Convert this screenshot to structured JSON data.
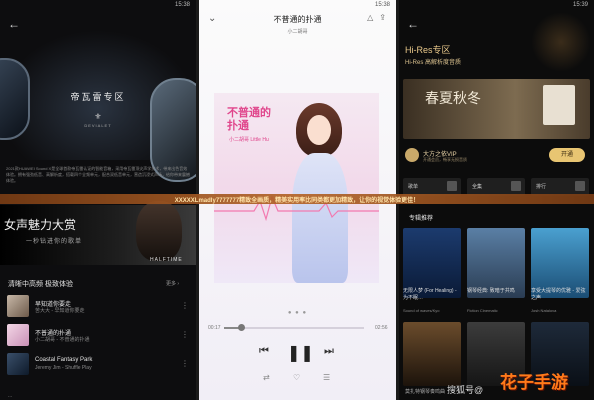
{
  "panel1": {
    "status": {
      "left": "",
      "time": "15:38"
    },
    "hero": {
      "title": "帝瓦雷专区",
      "logo": "DEVIALET",
      "logo_name": "DEVIALET"
    },
    "description": "2021款HUAWEI Sound X是全球首款帝瓦雷认证的智能音箱，采用帝瓦雷顶尖声学技术，带来出色音效体验。拥有强劲低音、高解析度，搭载四个全频单元，配合双低音单元，营造沉浸式声场，给你带来震撼体验。",
    "banner": {
      "title": "女声魅力大赏",
      "subtitle": "一秒钻进你的歌单",
      "tag": "HALFTIME"
    },
    "section": {
      "title": "清晰中高频 极致体验",
      "more": "更多"
    },
    "rows": [
      {
        "title": "早知道你要走",
        "sub": "苦大大 - 早知道你要走"
      },
      {
        "title": "不普通的扑通",
        "sub": "小二胡哥 - 不普通的扑通"
      },
      {
        "title": "Coastal Fantasy Park",
        "sub": "Jeremy Jim - Shuffle Play"
      }
    ],
    "bottom": "..."
  },
  "panel2": {
    "status": {
      "left": "",
      "time": "15:38"
    },
    "song_title": "不普通的扑通",
    "artist": "小二胡哥",
    "cover": {
      "title_l1": "不普通的",
      "title_l2": "扑通",
      "subtitle": "小二胡哥 Little Hu"
    },
    "time_current": "00:17",
    "time_total": "02:56",
    "progress": 0.12,
    "pager": "● ● ●"
  },
  "panel3": {
    "status": {
      "left": "",
      "time": "15:39"
    },
    "title": "Hi-Res专区",
    "subtitle": "Hi-Res 高解析度音质",
    "banner_title": "春夏秋冬",
    "vip": {
      "name": "大方之依VIP",
      "sub": "开通会员，畅享无损音质",
      "button": "开通"
    },
    "categories": [
      "歌单",
      "全集",
      "排行"
    ],
    "rec_title": "专辑推荐",
    "cards": [
      {
        "title": "无限人梦 (For Healing) - 为不眠…",
        "sub": "Sound of waves/Kyo"
      },
      {
        "title": "钢琴经典: 致暗于共鸣",
        "sub": "Fiction Cinematic"
      },
      {
        "title": "享受大提琴的优雅 - 爱弦之声",
        "sub": "Josh Natalova"
      }
    ],
    "bottom": "莫扎特钢琴奏鸣曲"
  },
  "overlay_band": "XXXXXLmadly7777777精致全画质，精美实用率比同类都更加精致，让你的视觉体验更佳！",
  "watermark": {
    "text": "搜狐号@",
    "brand": "花子手游"
  }
}
